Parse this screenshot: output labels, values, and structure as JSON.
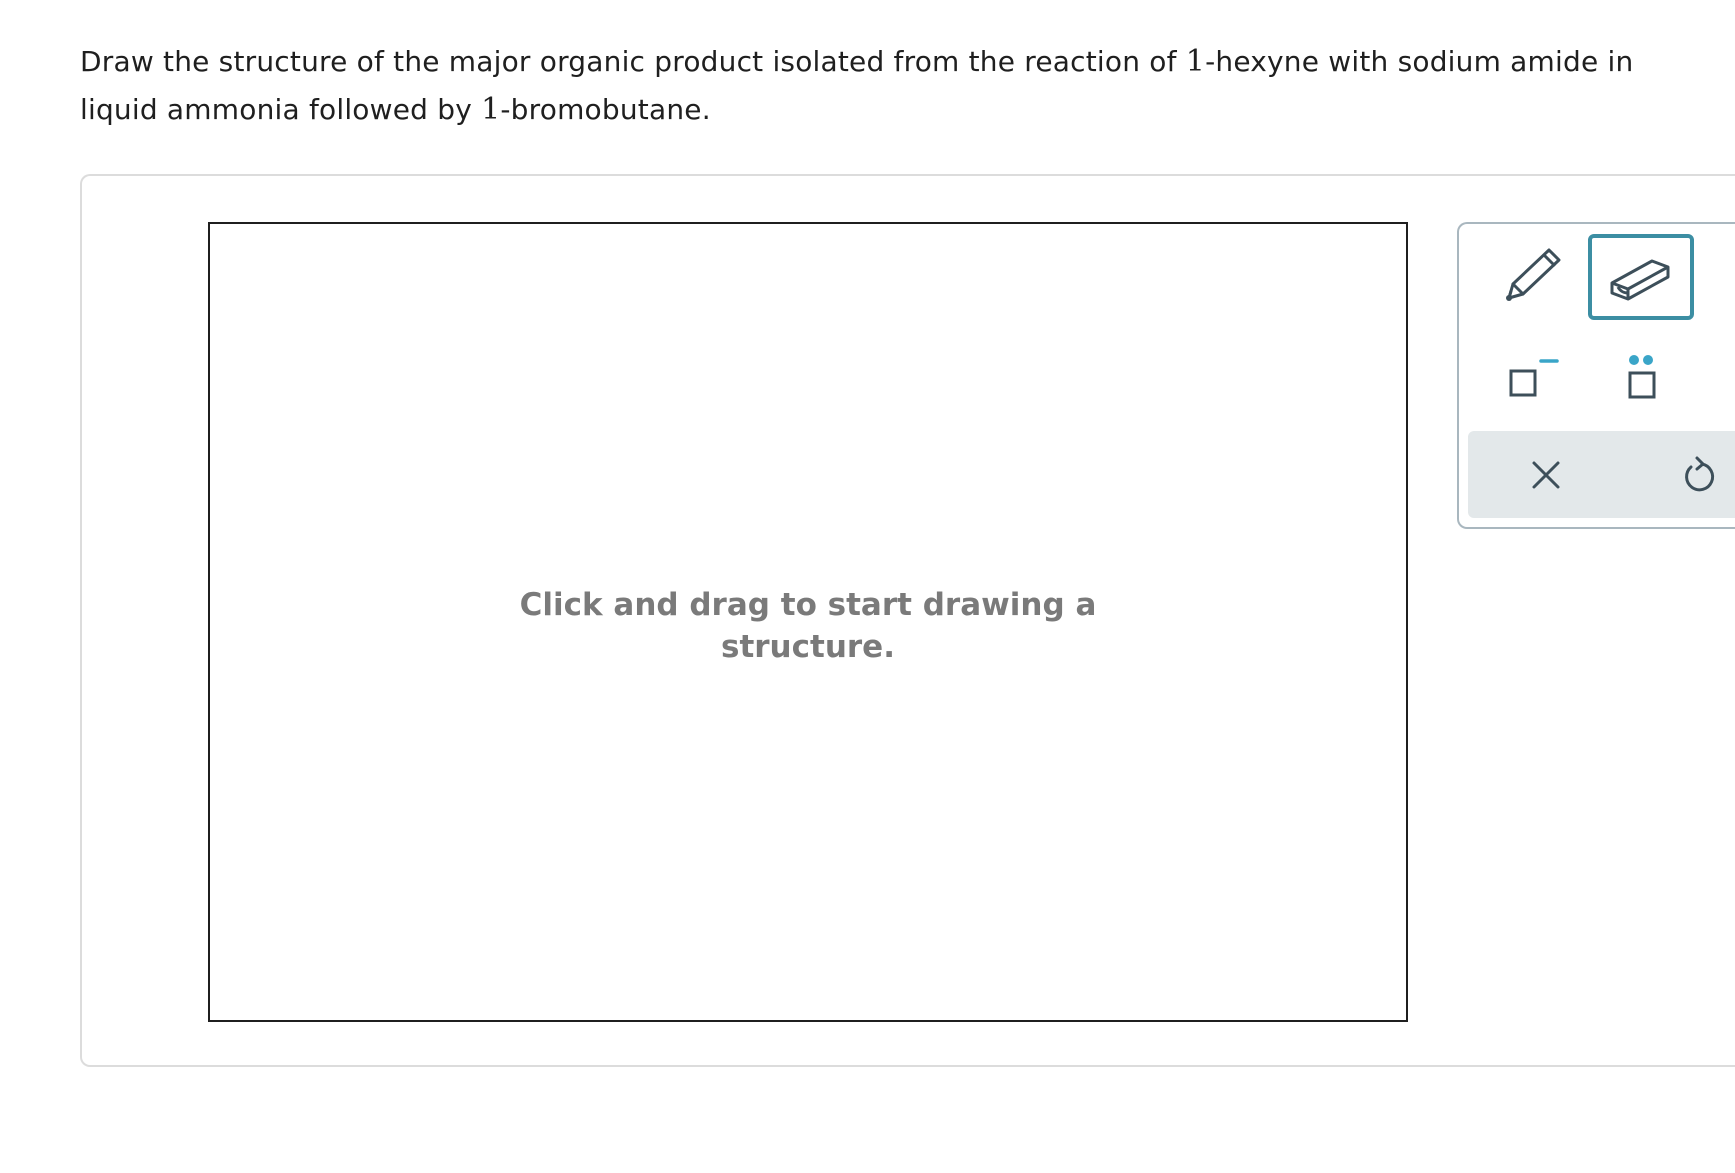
{
  "question": {
    "part1": "Draw the structure of the major organic product isolated from the reaction of ",
    "num1": "1",
    "part2": "-hexyne with sodium amide in liquid ammonia followed by ",
    "num2": "1",
    "part3": "-bromobutane."
  },
  "canvas": {
    "hint_line1": "Click and drag to start drawing a",
    "hint_line2": "structure."
  },
  "toolbar": {
    "tools": [
      {
        "name": "pencil",
        "icon": "pencil-icon",
        "active": false
      },
      {
        "name": "eraser",
        "icon": "eraser-icon",
        "active": true
      },
      {
        "name": "charge",
        "icon": "charge-icon",
        "active": false
      },
      {
        "name": "lone-pair",
        "icon": "lone-pair-icon",
        "active": false
      }
    ],
    "actions": [
      {
        "name": "clear",
        "icon": "close-icon"
      },
      {
        "name": "undo",
        "icon": "undo-icon"
      }
    ]
  },
  "colors": {
    "accent": "#3c8ea3",
    "icon": "#3d4f5a",
    "dots": "#3aa5c8",
    "hint": "#7a7a7a",
    "action_bar": "#e3e8ea"
  }
}
